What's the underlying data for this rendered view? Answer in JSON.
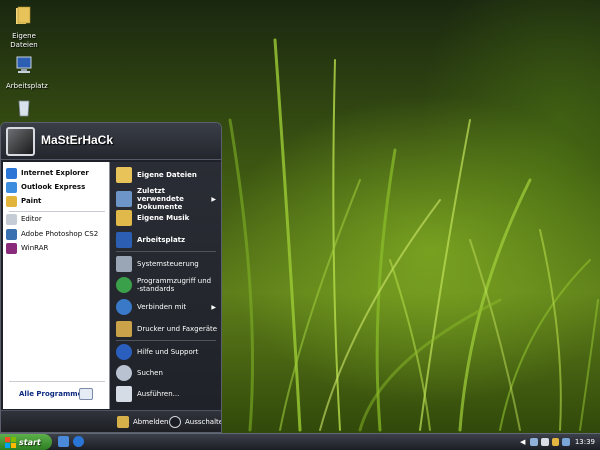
{
  "desktop": {
    "icons": [
      {
        "label": "Eigene Dateien",
        "icon": "folder-icon"
      },
      {
        "label": "Arbeitsplatz",
        "icon": "computer-icon"
      },
      {
        "label": "",
        "icon": "recycle-bin-icon"
      }
    ]
  },
  "start_menu": {
    "user_name": "MaStErHaCk",
    "pinned": [
      {
        "label": "Internet Explorer",
        "icon": "internet-explorer-icon"
      },
      {
        "label": "Outlook Express",
        "icon": "outlook-express-icon"
      },
      {
        "label": "Paint",
        "icon": "paint-icon"
      }
    ],
    "recent": [
      {
        "label": "Editor",
        "icon": "notepad-icon"
      },
      {
        "label": "Adobe Photoshop CS2",
        "icon": "photoshop-icon"
      },
      {
        "label": "WinRAR",
        "icon": "winrar-icon"
      }
    ],
    "all_programs": "Alle Programme",
    "places": [
      {
        "label": "Eigene Dateien",
        "icon": "folder-icon"
      },
      {
        "label": "Zuletzt verwendete Dokumente",
        "icon": "recent-documents-icon",
        "has_submenu": true
      },
      {
        "label": "Eigene Musik",
        "icon": "music-folder-icon"
      },
      {
        "label": "Arbeitsplatz",
        "icon": "computer-icon"
      }
    ],
    "system": [
      {
        "label": "Systemsteuerung",
        "icon": "control-panel-icon"
      },
      {
        "label": "Programmzugriff und -standards",
        "icon": "program-access-icon"
      },
      {
        "label": "Verbinden mit",
        "icon": "network-connect-icon",
        "has_submenu": true
      },
      {
        "label": "Drucker und Faxgeräte",
        "icon": "printer-icon"
      },
      {
        "label": "Hilfe und Support",
        "icon": "help-icon"
      },
      {
        "label": "Suchen",
        "icon": "search-icon"
      },
      {
        "label": "Ausführen...",
        "icon": "run-icon"
      }
    ],
    "footer": {
      "logoff": "Abmelden",
      "shutdown": "Ausschalten"
    }
  },
  "taskbar": {
    "start_label": "start",
    "clock": "13:39"
  },
  "colors": {
    "start_green": "#3f9a31",
    "menu_dark": "#1e2129",
    "link_blue": "#0d2a80"
  }
}
